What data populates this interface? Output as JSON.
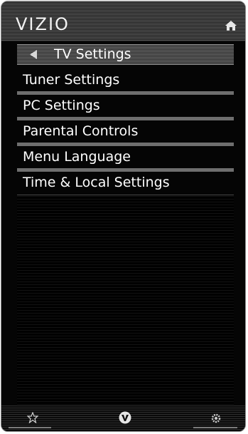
{
  "header": {
    "brand": "VIZIO",
    "home_icon": "home-icon"
  },
  "title_bar": {
    "back_icon": "back-arrow-icon",
    "title": "TV Settings"
  },
  "menu": {
    "items": [
      {
        "label": "Tuner Settings"
      },
      {
        "label": "PC Settings"
      },
      {
        "label": "Parental Controls"
      },
      {
        "label": "Menu Language"
      },
      {
        "label": "Time & Local Settings"
      }
    ]
  },
  "footer": {
    "icons": [
      "star-icon",
      "vizio-v-icon",
      "gear-icon"
    ]
  },
  "colors": {
    "background": "#050505",
    "text": "#ffffff",
    "accent_gray": "#6e6e6e"
  }
}
